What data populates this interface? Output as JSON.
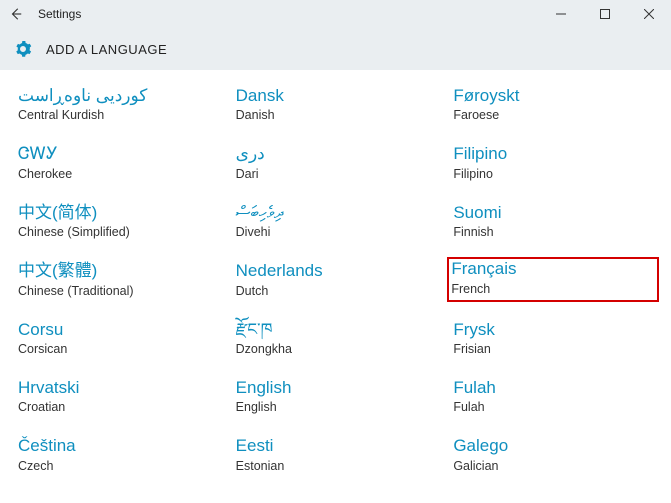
{
  "window": {
    "title": "Settings",
    "page_title": "ADD A LANGUAGE"
  },
  "languages": [
    {
      "native": "کوردیی ناوەڕاست",
      "english": "Central Kurdish",
      "highlight": false
    },
    {
      "native": "Dansk",
      "english": "Danish",
      "highlight": false
    },
    {
      "native": "Føroyskt",
      "english": "Faroese",
      "highlight": false
    },
    {
      "native": "ᏣᎳᎩ",
      "english": "Cherokee",
      "highlight": false
    },
    {
      "native": "درى",
      "english": "Dari",
      "highlight": false
    },
    {
      "native": "Filipino",
      "english": "Filipino",
      "highlight": false
    },
    {
      "native": "中文(简体)",
      "english": "Chinese (Simplified)",
      "highlight": false
    },
    {
      "native": "ދިވެހިބަސް",
      "english": "Divehi",
      "highlight": false
    },
    {
      "native": "Suomi",
      "english": "Finnish",
      "highlight": false
    },
    {
      "native": "中文(繁體)",
      "english": "Chinese (Traditional)",
      "highlight": false
    },
    {
      "native": "Nederlands",
      "english": "Dutch",
      "highlight": false
    },
    {
      "native": "Français",
      "english": "French",
      "highlight": true
    },
    {
      "native": "Corsu",
      "english": "Corsican",
      "highlight": false
    },
    {
      "native": "རྫོང་ཁ",
      "english": "Dzongkha",
      "highlight": false
    },
    {
      "native": "Frysk",
      "english": "Frisian",
      "highlight": false
    },
    {
      "native": "Hrvatski",
      "english": "Croatian",
      "highlight": false
    },
    {
      "native": "English",
      "english": "English",
      "highlight": false
    },
    {
      "native": "Fulah",
      "english": "Fulah",
      "highlight": false
    },
    {
      "native": "Čeština",
      "english": "Czech",
      "highlight": false
    },
    {
      "native": "Eesti",
      "english": "Estonian",
      "highlight": false
    },
    {
      "native": "Galego",
      "english": "Galician",
      "highlight": false
    }
  ]
}
